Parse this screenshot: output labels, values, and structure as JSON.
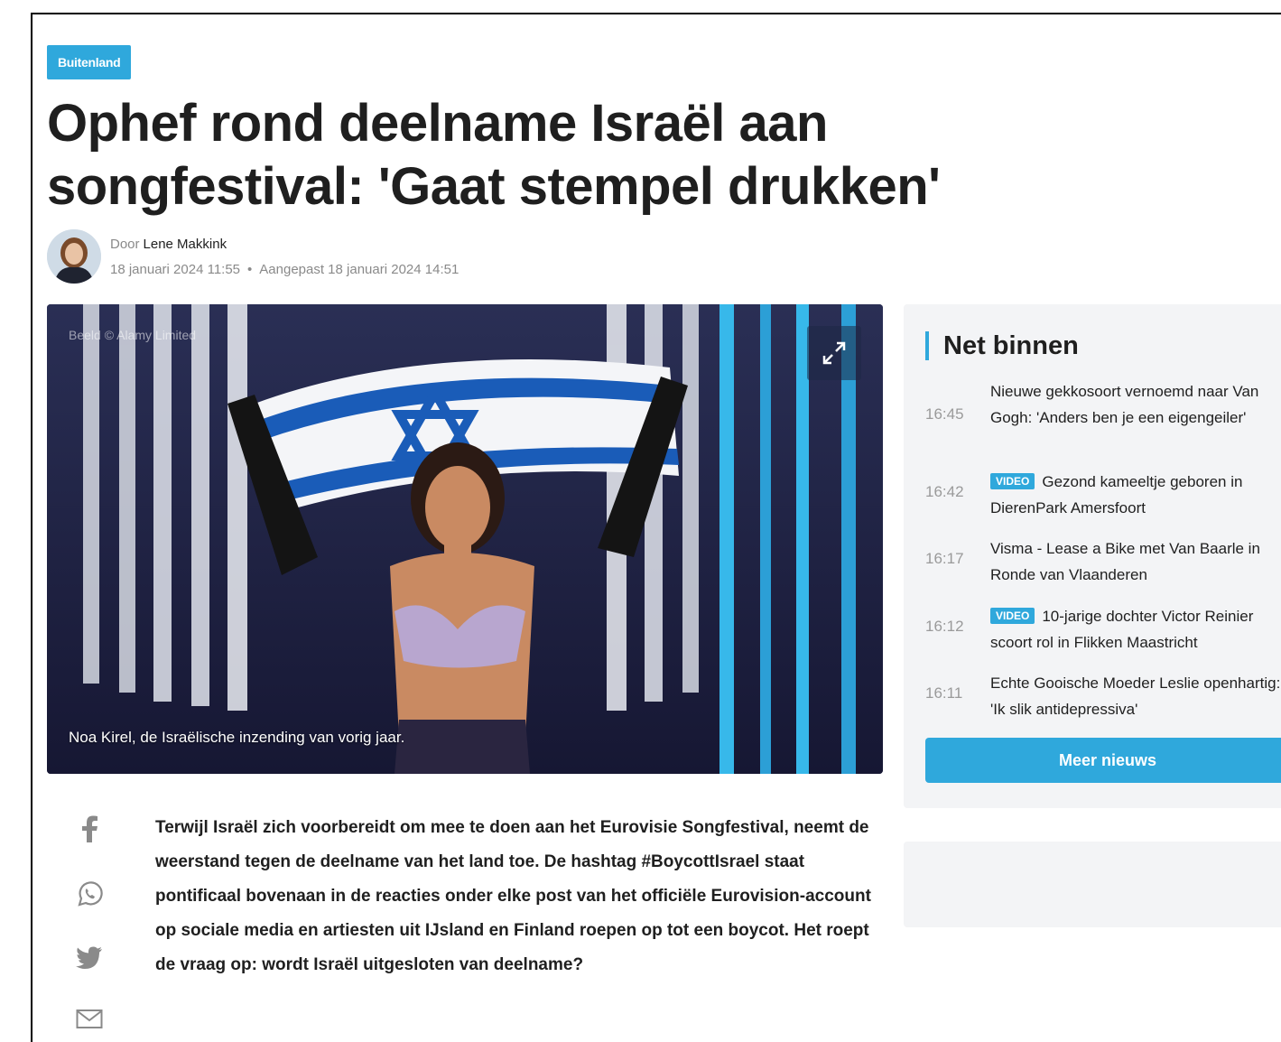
{
  "article": {
    "category": "Buitenland",
    "headline": "Ophef rond deelname Israël aan songfestival: 'Gaat stempel drukken'",
    "byline_prefix": "Door",
    "author": "Lene Makkink",
    "published": "18 januari 2024 11:55",
    "separator": "•",
    "updated": "Aangepast 18 januari 2024 14:51",
    "image_credit": "Beeld © Alamy Limited",
    "image_caption": "Noa Kirel, de Israëlische inzending van vorig jaar.",
    "intro": "Terwijl Israël zich voorbereidt om mee te doen aan het Eurovisie Songfestival, neemt de weerstand tegen de deelname van het land toe. De hashtag #BoycottIsrael staat pontificaal bovenaan in de reacties onder elke post van het officiële Eurovision-account op sociale media en artiesten uit IJsland en Finland roepen op tot een boycot. Het roept de vraag op: wordt Israël uitgesloten van deelname?"
  },
  "share_icons": [
    "facebook-icon",
    "whatsapp-icon",
    "twitter-icon",
    "mail-icon"
  ],
  "sidebar": {
    "title": "Net binnen",
    "items": [
      {
        "time": "16:45",
        "badge": "",
        "text": "Nieuwe gekkosoort vernoemd naar Van Gogh: 'Anders ben je een eigengeiler'"
      },
      {
        "time": "16:42",
        "badge": "VIDEO",
        "text": "Gezond kameeltje geboren in DierenPark Amersfoort"
      },
      {
        "time": "16:17",
        "badge": "",
        "text": "Visma - Lease a Bike met Van Baarle in Ronde van Vlaanderen"
      },
      {
        "time": "16:12",
        "badge": "VIDEO",
        "text": "10-jarige dochter Victor Reinier scoort rol in Flikken Maastricht"
      },
      {
        "time": "16:11",
        "badge": "",
        "text": "Echte Gooische Moeder Leslie openhartig: 'Ik slik antidepressiva'"
      }
    ],
    "more_label": "Meer nieuws"
  },
  "colors": {
    "accent": "#2fa8dc",
    "text": "#1f1f1f",
    "muted": "#8a8a8a",
    "panel": "#f3f4f6"
  }
}
